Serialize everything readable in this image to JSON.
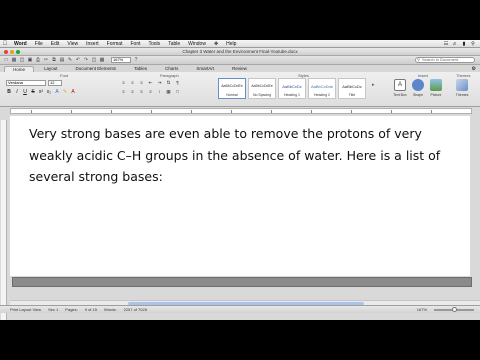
{
  "menubar": {
    "app": "Word",
    "items": [
      "File",
      "Edit",
      "View",
      "Insert",
      "Format",
      "Font",
      "Tools",
      "Table",
      "Window",
      "Help"
    ],
    "status_icons": [
      "wifi-icon",
      "volume-icon",
      "battery-icon",
      "search-icon"
    ]
  },
  "window": {
    "title": "Chapter 3 Water and the Environment Final-Youtube.docx",
    "traffic_colors": [
      "#e0443e",
      "#dea123",
      "#1aab29"
    ]
  },
  "toolbar": {
    "zoom": "167%",
    "search_placeholder": "Search in Document"
  },
  "ribbon": {
    "tabs": [
      "Home",
      "Layout",
      "Document Elements",
      "Tables",
      "Charts",
      "SmartArt",
      "Review"
    ],
    "active_tab": "Home",
    "groups": {
      "font": "Font",
      "paragraph": "Paragraph",
      "styles": "Styles",
      "insert": "Insert",
      "themes": "Themes"
    },
    "font_name": "Verdana",
    "font_size": "12",
    "styles": [
      {
        "sample": "AaBbCcDdEe",
        "name": "Normal"
      },
      {
        "sample": "AaBbCcDdEe",
        "name": "No Spacing"
      },
      {
        "sample": "AaBbCcDc",
        "name": "Heading 1"
      },
      {
        "sample": "AaBbCcDde",
        "name": "Heading 2"
      },
      {
        "sample": "AaBbCcDc",
        "name": "Title"
      }
    ],
    "insert_buttons": [
      "Text Box",
      "Shape",
      "Picture"
    ],
    "themes_button": "Themes",
    "accent": "#2f4f8f"
  },
  "document": {
    "body": "Very strong bases are even able to remove the protons of very weakly acidic C–H groups in the absence of water. Here is a list of several strong bases:"
  },
  "status": {
    "view": "Print Layout View",
    "section": "Sec 1",
    "pages_label": "Pages:",
    "pages": "9 of 15",
    "words_label": "Words:",
    "words": "2257 of 7025",
    "zoom": "167%"
  }
}
